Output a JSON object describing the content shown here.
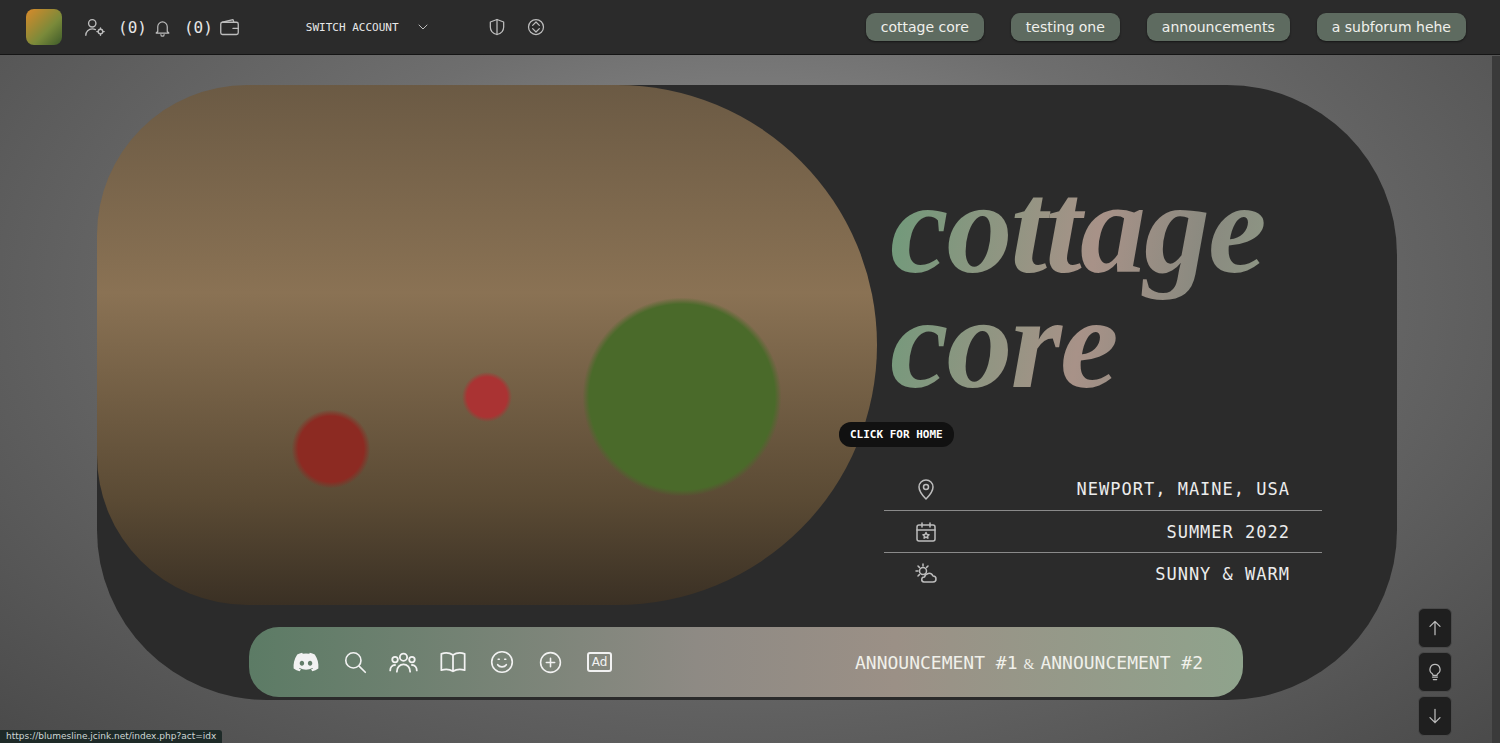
{
  "top_bar": {
    "notifications_count": "(0)",
    "wallet_count": "(0)",
    "switch_account": "SWITCH ACCOUNT",
    "nav": [
      {
        "label": "cottage core"
      },
      {
        "label": "testing one"
      },
      {
        "label": "announcements"
      },
      {
        "label": "a subforum hehe"
      }
    ]
  },
  "header": {
    "title_lines": [
      "cottage",
      "core"
    ],
    "tooltip": "CLICK FOR HOME",
    "info": [
      {
        "text": "NEWPORT, MAINE, USA"
      },
      {
        "text": "SUMMER 2022"
      },
      {
        "text": "SUNNY & WARM"
      }
    ]
  },
  "toolbar": {
    "ad_label": "Ad",
    "announcement": [
      "ANNOUNCEMENT #1",
      "&",
      "ANNOUNCEMENT #2"
    ]
  },
  "status_bar": {
    "url": "https://blumesline.jcink.net/index.php?act=idx"
  }
}
